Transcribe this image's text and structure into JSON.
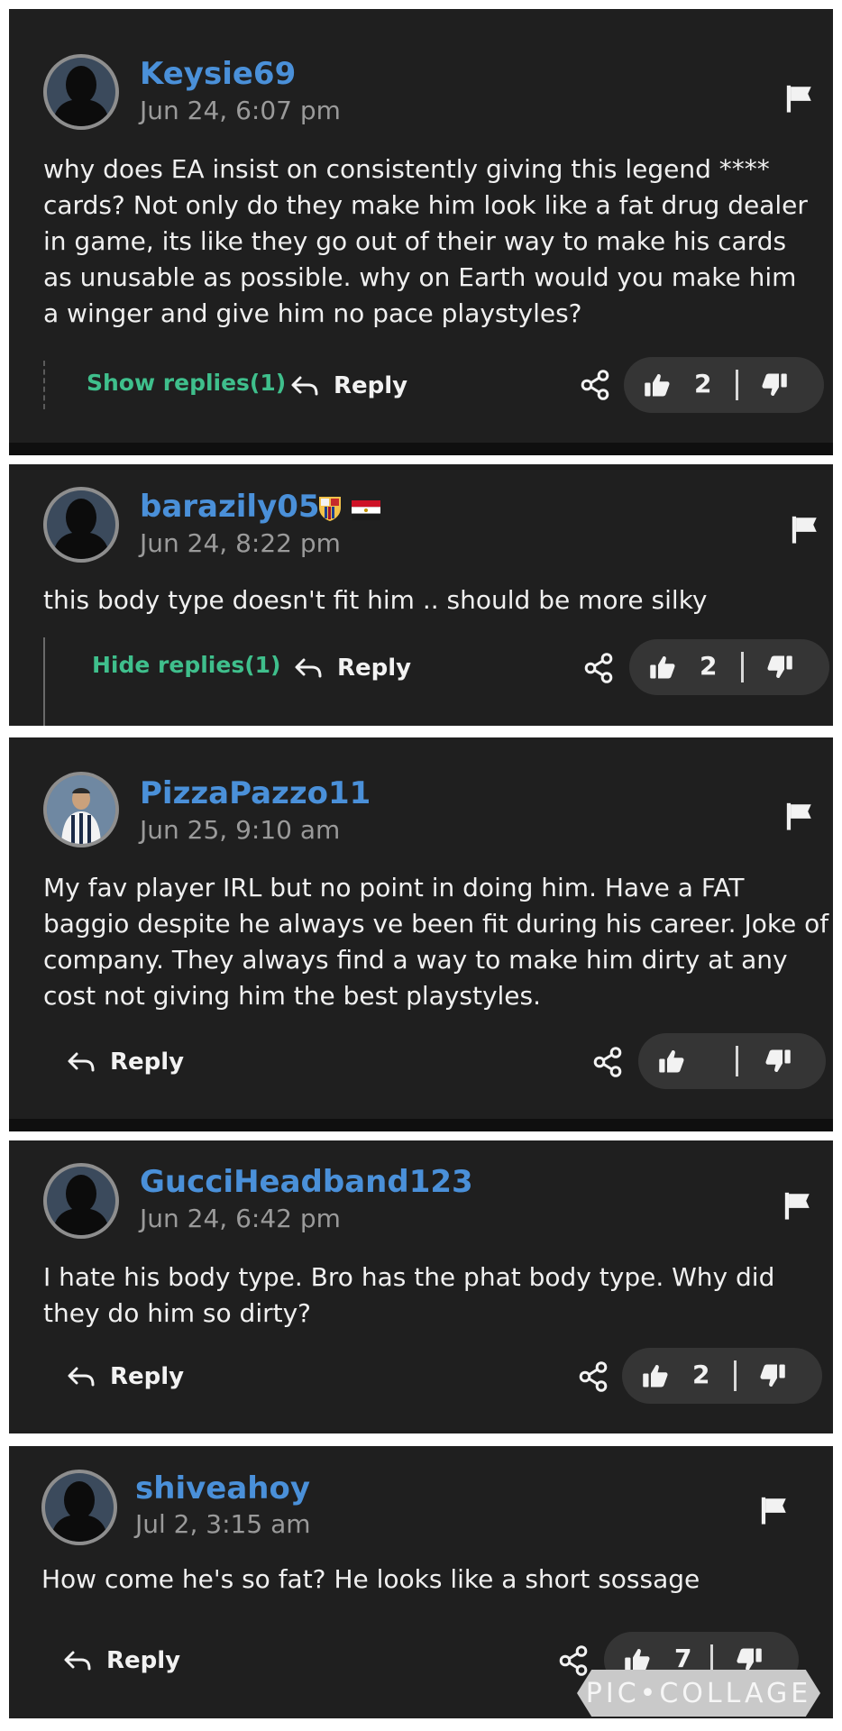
{
  "comments": [
    {
      "username": "Keysie69",
      "timestamp": "Jun 24, 6:07 pm",
      "body": "why does EA insist on consistently giving this legend **** cards? Not only do they make him look like a fat drug dealer in game, its like they go out of their way to make his cards as unusable as possible. why on Earth would you make him a winger and give him no pace playstyles?",
      "replies_toggle": "Show replies(1)",
      "reply_label": "Reply",
      "likes": "2"
    },
    {
      "username": "barazily05",
      "timestamp": "Jun 24, 8:22 pm",
      "body": "this body type doesn't fit him .. should be more silky",
      "replies_toggle": "Hide replies(1)",
      "reply_label": "Reply",
      "likes": "2"
    },
    {
      "username": "PizzaPazzo11",
      "timestamp": "Jun 25, 9:10 am",
      "body": "My fav player IRL but no point in doing him. Have a FAT baggio despite he always ve been fit during his career. Joke of company. They always find a way to make him dirty at any cost not giving him the best playstyles.",
      "reply_label": "Reply",
      "likes": ""
    },
    {
      "username": "GucciHeadband123",
      "timestamp": "Jun 24, 6:42 pm",
      "body": "I hate his body type. Bro has the phat body type. Why did they do him so dirty?",
      "reply_label": "Reply",
      "likes": "2"
    },
    {
      "username": "shiveahoy",
      "timestamp": "Jul 2, 3:15 am",
      "body": "How come he's so fat? He looks like a short sossage",
      "reply_label": "Reply",
      "likes": "7"
    }
  ],
  "watermark": "PIC•COLLAGE",
  "colors": {
    "card_background": "#1f1f1f",
    "username": "#4a90d9",
    "replies_toggle": "#3fbf8c",
    "timestamp": "#9a9a9a",
    "vote_pill": "#353535"
  },
  "icons": [
    "avatar-silhouette",
    "flag-icon",
    "reply-arrow-icon",
    "share-icon",
    "thumbs-up-icon",
    "thumbs-down-icon",
    "barcelona-crest-icon",
    "egypt-flag-icon"
  ]
}
